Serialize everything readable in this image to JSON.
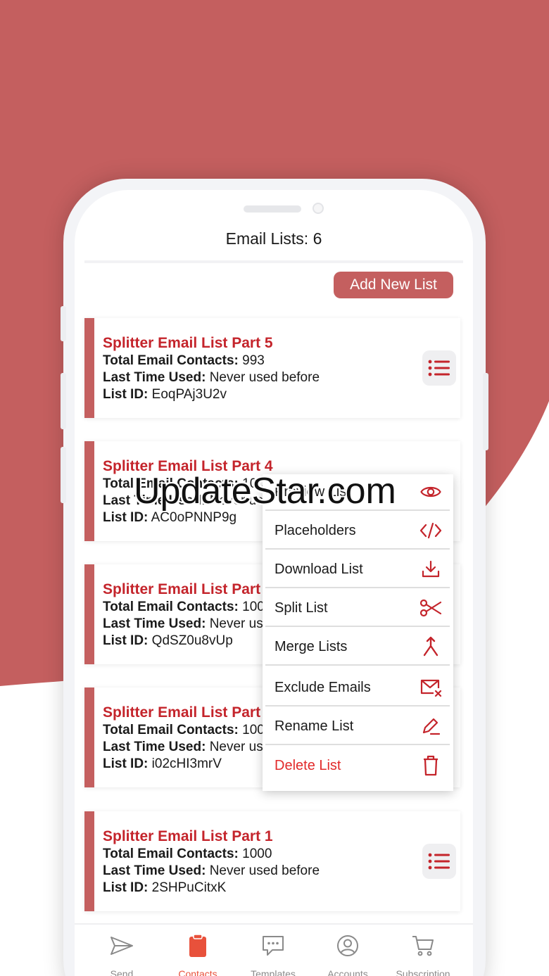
{
  "header": {
    "title": "Email Lists: 6"
  },
  "toolbar": {
    "add_label": "Add New List"
  },
  "lists": [
    {
      "name": "Splitter Email List Part 5",
      "contacts_label": "Total Email Contacts:",
      "contacts": "993",
      "last_used_label": "Last Time Used:",
      "last_used": "Never used before",
      "id_label": "List ID:",
      "id": "EoqPAj3U2v"
    },
    {
      "name": "Splitter Email List Part 4",
      "contacts_label": "Total Email Contacts:",
      "contacts": "100",
      "last_used_label": "Last Time Used:",
      "last_used": "Never us",
      "id_label": "List ID:",
      "id": "AC0oPNNP9g"
    },
    {
      "name": "Splitter Email List Part",
      "contacts_label": "Total Email Contacts:",
      "contacts": "100",
      "last_used_label": "Last Time Used:",
      "last_used": "Never us",
      "id_label": "List ID:",
      "id": "QdSZ0u8vUp"
    },
    {
      "name": "Splitter Email List Part",
      "contacts_label": "Total Email Contacts:",
      "contacts": "100",
      "last_used_label": "Last Time Used:",
      "last_used": "Never us",
      "id_label": "List ID:",
      "id": "i02cHI3mrV"
    },
    {
      "name": "Splitter Email List Part 1",
      "contacts_label": "Total Email Contacts:",
      "contacts": "1000",
      "last_used_label": "Last Time Used:",
      "last_used": "Never used before",
      "id_label": "List ID:",
      "id": "2SHPuCitxK"
    }
  ],
  "context_menu": {
    "items": [
      {
        "label": "Preview List",
        "icon": "eye-icon"
      },
      {
        "label": "Placeholders",
        "icon": "code-icon"
      },
      {
        "label": "Download List",
        "icon": "download-icon"
      },
      {
        "label": "Split List",
        "icon": "scissors-icon"
      },
      {
        "label": "Merge Lists",
        "icon": "merge-icon"
      },
      {
        "label": "Exclude Emails",
        "icon": "mail-x-icon"
      },
      {
        "label": "Rename List",
        "icon": "pen-icon"
      },
      {
        "label": "Delete List",
        "icon": "trash-icon"
      }
    ]
  },
  "watermark": {
    "text": "UpdateStar.com"
  },
  "tabs": [
    {
      "label": "Send",
      "icon": "send-icon"
    },
    {
      "label": "Contacts",
      "icon": "clipboard-icon",
      "active": true
    },
    {
      "label": "Templates",
      "icon": "chat-icon"
    },
    {
      "label": "Accounts",
      "icon": "user-circle-icon"
    },
    {
      "label": "Subscription",
      "icon": "cart-icon"
    }
  ],
  "colors": {
    "accent": "#c45f5f",
    "name_red": "#c4242b",
    "danger": "#e22a2a",
    "active_tab": "#e8513b"
  }
}
